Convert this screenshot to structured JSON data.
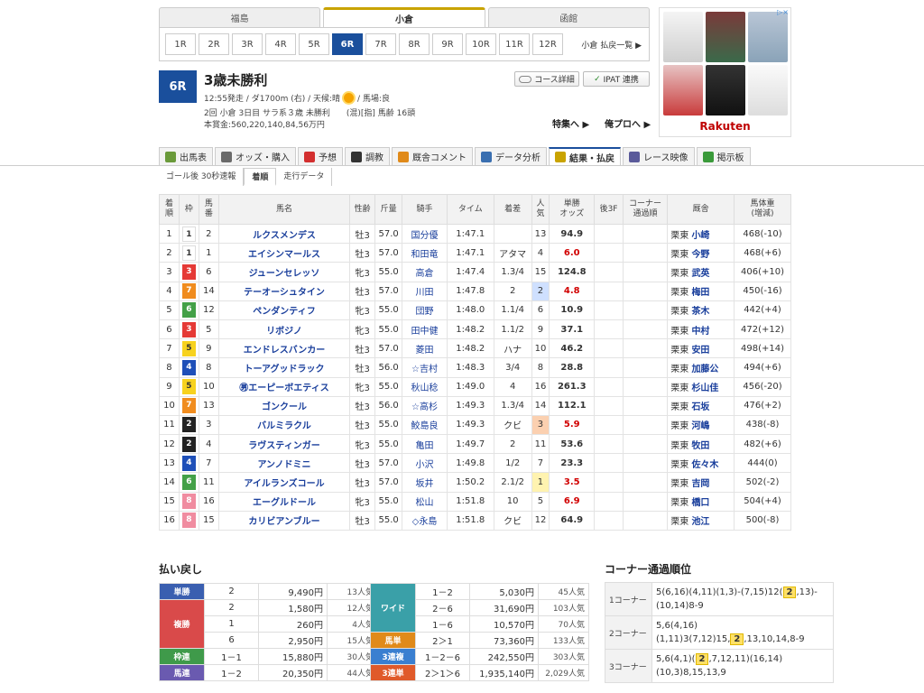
{
  "venues": [
    {
      "label": "福島",
      "active": false
    },
    {
      "label": "小倉",
      "active": true
    },
    {
      "label": "函館",
      "active": false
    }
  ],
  "races": [
    "1R",
    "2R",
    "3R",
    "4R",
    "5R",
    "6R",
    "7R",
    "8R",
    "9R",
    "10R",
    "11R",
    "12R"
  ],
  "active_race": "6R",
  "payout_list_link": "小倉 払戻一覧 ▶",
  "race": {
    "number": "6R",
    "title": "3歳未勝利",
    "info1_a": "12:55発走 / ダ1700m (右) / 天候:晴",
    "info1_b": "/ 馬場:良",
    "info2": "2回 小倉 3日目 サラ系３歳 未勝利　　(混)[指] 馬齢 16頭",
    "info3": "本賞金:560,220,140,84,56万円"
  },
  "buttons": {
    "course": "コース詳細",
    "ipat": "IPAT 連携",
    "feature": "特集へ ▶",
    "orepro": "俺プロへ ▶"
  },
  "ad": {
    "logo": "Rakuten",
    "close": "▷×"
  },
  "nav": {
    "tabs": [
      {
        "label": "出馬表",
        "icon": "table-icon",
        "color": "#6a9a3a",
        "active": false
      },
      {
        "label": "オッズ・購入",
        "icon": "odds-icon",
        "color": "#6a6a6a",
        "active": false
      },
      {
        "label": "予想",
        "icon": "target-icon",
        "color": "#d32f2f",
        "active": false
      },
      {
        "label": "調教",
        "icon": "stopwatch-icon",
        "color": "#333333",
        "active": false
      },
      {
        "label": "厩舎コメント",
        "icon": "comment-icon",
        "color": "#e08a1a",
        "active": false
      },
      {
        "label": "データ分析",
        "icon": "bar-chart-icon",
        "color": "#3a6fb0",
        "active": false
      },
      {
        "label": "結果・払戻",
        "icon": "coin-icon",
        "color": "#c9a300",
        "active": true
      },
      {
        "label": "レース映像",
        "icon": "video-icon",
        "color": "#5a5a9a",
        "active": false
      },
      {
        "label": "掲示板",
        "icon": "chat-icon",
        "color": "#3a9a3a",
        "active": false
      }
    ]
  },
  "subtabs": [
    {
      "label": "ゴール後 30秒速報",
      "active": false
    },
    {
      "label": "着順",
      "active": true
    },
    {
      "label": "走行データ",
      "active": false
    }
  ],
  "results_headers": [
    "着\n順",
    "枠",
    "馬\n番",
    "馬名",
    "性齢",
    "斤量",
    "騎手",
    "タイム",
    "着差",
    "人\n気",
    "単勝\nオッズ",
    "後3F",
    "コーナー\n通過順",
    "厩舎",
    "馬体重\n(増減)"
  ],
  "results": [
    {
      "rank": "1",
      "waku": "1",
      "num": "2",
      "horse": "ルクスメンデス",
      "sex": "牡3",
      "weight": "57.0",
      "jockey": "国分優",
      "time": "1:47.1",
      "margin": "",
      "pop": "13",
      "odds": "94.9",
      "odds_red": false,
      "region": "栗東",
      "trainer": "小崎",
      "hw": "468(-10)"
    },
    {
      "rank": "2",
      "waku": "1",
      "num": "1",
      "horse": "エイシンマールス",
      "sex": "牡3",
      "weight": "57.0",
      "jockey": "和田竜",
      "time": "1:47.1",
      "margin": "アタマ",
      "pop": "4",
      "odds": "6.0",
      "odds_red": true,
      "region": "栗東",
      "trainer": "今野",
      "hw": "468(+6)"
    },
    {
      "rank": "3",
      "waku": "3",
      "num": "6",
      "horse": "ジューンセレッソ",
      "sex": "牝3",
      "weight": "55.0",
      "jockey": "高倉",
      "time": "1:47.4",
      "margin": "1.3/4",
      "pop": "15",
      "odds": "124.8",
      "odds_red": false,
      "region": "栗東",
      "trainer": "武英",
      "hw": "406(+10)"
    },
    {
      "rank": "4",
      "waku": "7",
      "num": "14",
      "horse": "テーオーシュタイン",
      "sex": "牡3",
      "weight": "57.0",
      "jockey": "川田",
      "time": "1:47.8",
      "margin": "2",
      "pop": "2",
      "odds": "4.8",
      "odds_red": true,
      "region": "栗東",
      "trainer": "梅田",
      "hw": "450(-16)"
    },
    {
      "rank": "5",
      "waku": "6",
      "num": "12",
      "horse": "ペンダンティフ",
      "sex": "牝3",
      "weight": "55.0",
      "jockey": "団野",
      "time": "1:48.0",
      "margin": "1.1/4",
      "pop": "6",
      "odds": "10.9",
      "odds_red": false,
      "region": "栗東",
      "trainer": "茶木",
      "hw": "442(+4)"
    },
    {
      "rank": "6",
      "waku": "3",
      "num": "5",
      "horse": "リボジノ",
      "sex": "牝3",
      "weight": "55.0",
      "jockey": "田中健",
      "time": "1:48.2",
      "margin": "1.1/2",
      "pop": "9",
      "odds": "37.1",
      "odds_red": false,
      "region": "栗東",
      "trainer": "中村",
      "hw": "472(+12)"
    },
    {
      "rank": "7",
      "waku": "5",
      "num": "9",
      "horse": "エンドレスバンカー",
      "sex": "牡3",
      "weight": "57.0",
      "jockey": "菱田",
      "time": "1:48.2",
      "margin": "ハナ",
      "pop": "10",
      "odds": "46.2",
      "odds_red": false,
      "region": "栗東",
      "trainer": "安田",
      "hw": "498(+14)"
    },
    {
      "rank": "8",
      "waku": "4",
      "num": "8",
      "horse": "トーアグッドラック",
      "sex": "牡3",
      "weight": "56.0",
      "jockey": "☆吉村",
      "time": "1:48.3",
      "margin": "3/4",
      "pop": "8",
      "odds": "28.8",
      "odds_red": false,
      "region": "栗東",
      "trainer": "加藤公",
      "hw": "494(+6)"
    },
    {
      "rank": "9",
      "waku": "5",
      "num": "10",
      "horse": "㊚エーピーボエティス",
      "sex": "牝3",
      "weight": "55.0",
      "jockey": "秋山稔",
      "time": "1:49.0",
      "margin": "4",
      "pop": "16",
      "odds": "261.3",
      "odds_red": false,
      "region": "栗東",
      "trainer": "杉山佳",
      "hw": "456(-20)"
    },
    {
      "rank": "10",
      "waku": "7",
      "num": "13",
      "horse": "ゴンクール",
      "sex": "牡3",
      "weight": "56.0",
      "jockey": "☆高杉",
      "time": "1:49.3",
      "margin": "1.3/4",
      "pop": "14",
      "odds": "112.1",
      "odds_red": false,
      "region": "栗東",
      "trainer": "石坂",
      "hw": "476(+2)"
    },
    {
      "rank": "11",
      "waku": "2",
      "num": "3",
      "horse": "バルミラクル",
      "sex": "牡3",
      "weight": "55.0",
      "jockey": "鮫島良",
      "time": "1:49.3",
      "margin": "クビ",
      "pop": "3",
      "odds": "5.9",
      "odds_red": true,
      "region": "栗東",
      "trainer": "河嶋",
      "hw": "438(-8)"
    },
    {
      "rank": "12",
      "waku": "2",
      "num": "4",
      "horse": "ラヴスティンガー",
      "sex": "牝3",
      "weight": "55.0",
      "jockey": "亀田",
      "time": "1:49.7",
      "margin": "2",
      "pop": "11",
      "odds": "53.6",
      "odds_red": false,
      "region": "栗東",
      "trainer": "牧田",
      "hw": "482(+6)"
    },
    {
      "rank": "13",
      "waku": "4",
      "num": "7",
      "horse": "アンノドミニ",
      "sex": "牡3",
      "weight": "57.0",
      "jockey": "小沢",
      "time": "1:49.8",
      "margin": "1/2",
      "pop": "7",
      "odds": "23.3",
      "odds_red": false,
      "region": "栗東",
      "trainer": "佐々木",
      "hw": "444(0)"
    },
    {
      "rank": "14",
      "waku": "6",
      "num": "11",
      "horse": "アイルランズコール",
      "sex": "牡3",
      "weight": "57.0",
      "jockey": "坂井",
      "time": "1:50.2",
      "margin": "2.1/2",
      "pop": "1",
      "odds": "3.5",
      "odds_red": true,
      "region": "栗東",
      "trainer": "吉岡",
      "hw": "502(-2)"
    },
    {
      "rank": "15",
      "waku": "8",
      "num": "16",
      "horse": "エーグルドール",
      "sex": "牝3",
      "weight": "55.0",
      "jockey": "松山",
      "time": "1:51.8",
      "margin": "10",
      "pop": "5",
      "odds": "6.9",
      "odds_red": true,
      "region": "栗東",
      "trainer": "橋口",
      "hw": "504(+4)"
    },
    {
      "rank": "16",
      "waku": "8",
      "num": "15",
      "horse": "カリビアンブルー",
      "sex": "牡3",
      "weight": "55.0",
      "jockey": "◇永島",
      "time": "1:51.8",
      "margin": "クビ",
      "pop": "12",
      "odds": "64.9",
      "odds_red": false,
      "region": "栗東",
      "trainer": "池江",
      "hw": "500(-8)"
    }
  ],
  "waku_colors": {
    "1": {
      "bg": "#ffffff",
      "fg": "#333333"
    },
    "2": {
      "bg": "#222222",
      "fg": "#ffffff"
    },
    "3": {
      "bg": "#e53935",
      "fg": "#ffffff"
    },
    "4": {
      "bg": "#1e4fb8",
      "fg": "#ffffff"
    },
    "5": {
      "bg": "#f7d21e",
      "fg": "#333333"
    },
    "6": {
      "bg": "#43a047",
      "fg": "#ffffff"
    },
    "7": {
      "bg": "#f08c1e",
      "fg": "#ffffff"
    },
    "8": {
      "bg": "#f08ca0",
      "fg": "#ffffff"
    }
  },
  "payouts_title": "払い戻し",
  "payouts_left": [
    {
      "label": "単勝",
      "color": "#3a5fb0",
      "rows": [
        {
          "comb": "2",
          "amount": "9,490円",
          "pop": "13人気"
        }
      ]
    },
    {
      "label": "複勝",
      "color": "#d94a4a",
      "rows": [
        {
          "comb": "2",
          "amount": "1,580円",
          "pop": "12人気"
        },
        {
          "comb": "1",
          "amount": "260円",
          "pop": "4人気"
        },
        {
          "comb": "6",
          "amount": "2,950円",
          "pop": "15人気"
        }
      ]
    },
    {
      "label": "枠連",
      "color": "#3f9a4a",
      "rows": [
        {
          "comb": "1－1",
          "amount": "15,880円",
          "pop": "30人気"
        }
      ]
    },
    {
      "label": "馬連",
      "color": "#6a5ab0",
      "rows": [
        {
          "comb": "1－2",
          "amount": "20,350円",
          "pop": "44人気"
        }
      ]
    }
  ],
  "payouts_right": [
    {
      "label": "ワイド",
      "color": "#3aa0a8",
      "rows": [
        {
          "comb": "1－2",
          "amount": "5,030円",
          "pop": "45人気"
        },
        {
          "comb": "2－6",
          "amount": "31,690円",
          "pop": "103人気"
        },
        {
          "comb": "1－6",
          "amount": "10,570円",
          "pop": "70人気"
        }
      ]
    },
    {
      "label": "馬単",
      "color": "#e08a1a",
      "rows": [
        {
          "comb": "2＞1",
          "amount": "73,360円",
          "pop": "133人気"
        }
      ]
    },
    {
      "label": "3連複",
      "color": "#3a7fd0",
      "rows": [
        {
          "comb": "1－2－6",
          "amount": "242,550円",
          "pop": "303人気"
        }
      ]
    },
    {
      "label": "3連単",
      "color": "#e05a2a",
      "rows": [
        {
          "comb": "2＞1＞6",
          "amount": "1,935,140円",
          "pop": "2,029人気"
        }
      ]
    }
  ],
  "corner_title": "コーナー通過順位",
  "corners": [
    {
      "label": "1コーナー",
      "text": "5(6,16)(4,11)(1,3)-(7,15)12( 2 ,13)-(10,14)8-9"
    },
    {
      "label": "2コーナー",
      "text": "5,6(4,16)(1,11)3(7,12)15, 2 ,13,10,14,8-9"
    },
    {
      "label": "3コーナー",
      "text": "5,6(4,1)( 2 ,7,12,11)(16,14)(10,3)8,15,13,9"
    }
  ]
}
